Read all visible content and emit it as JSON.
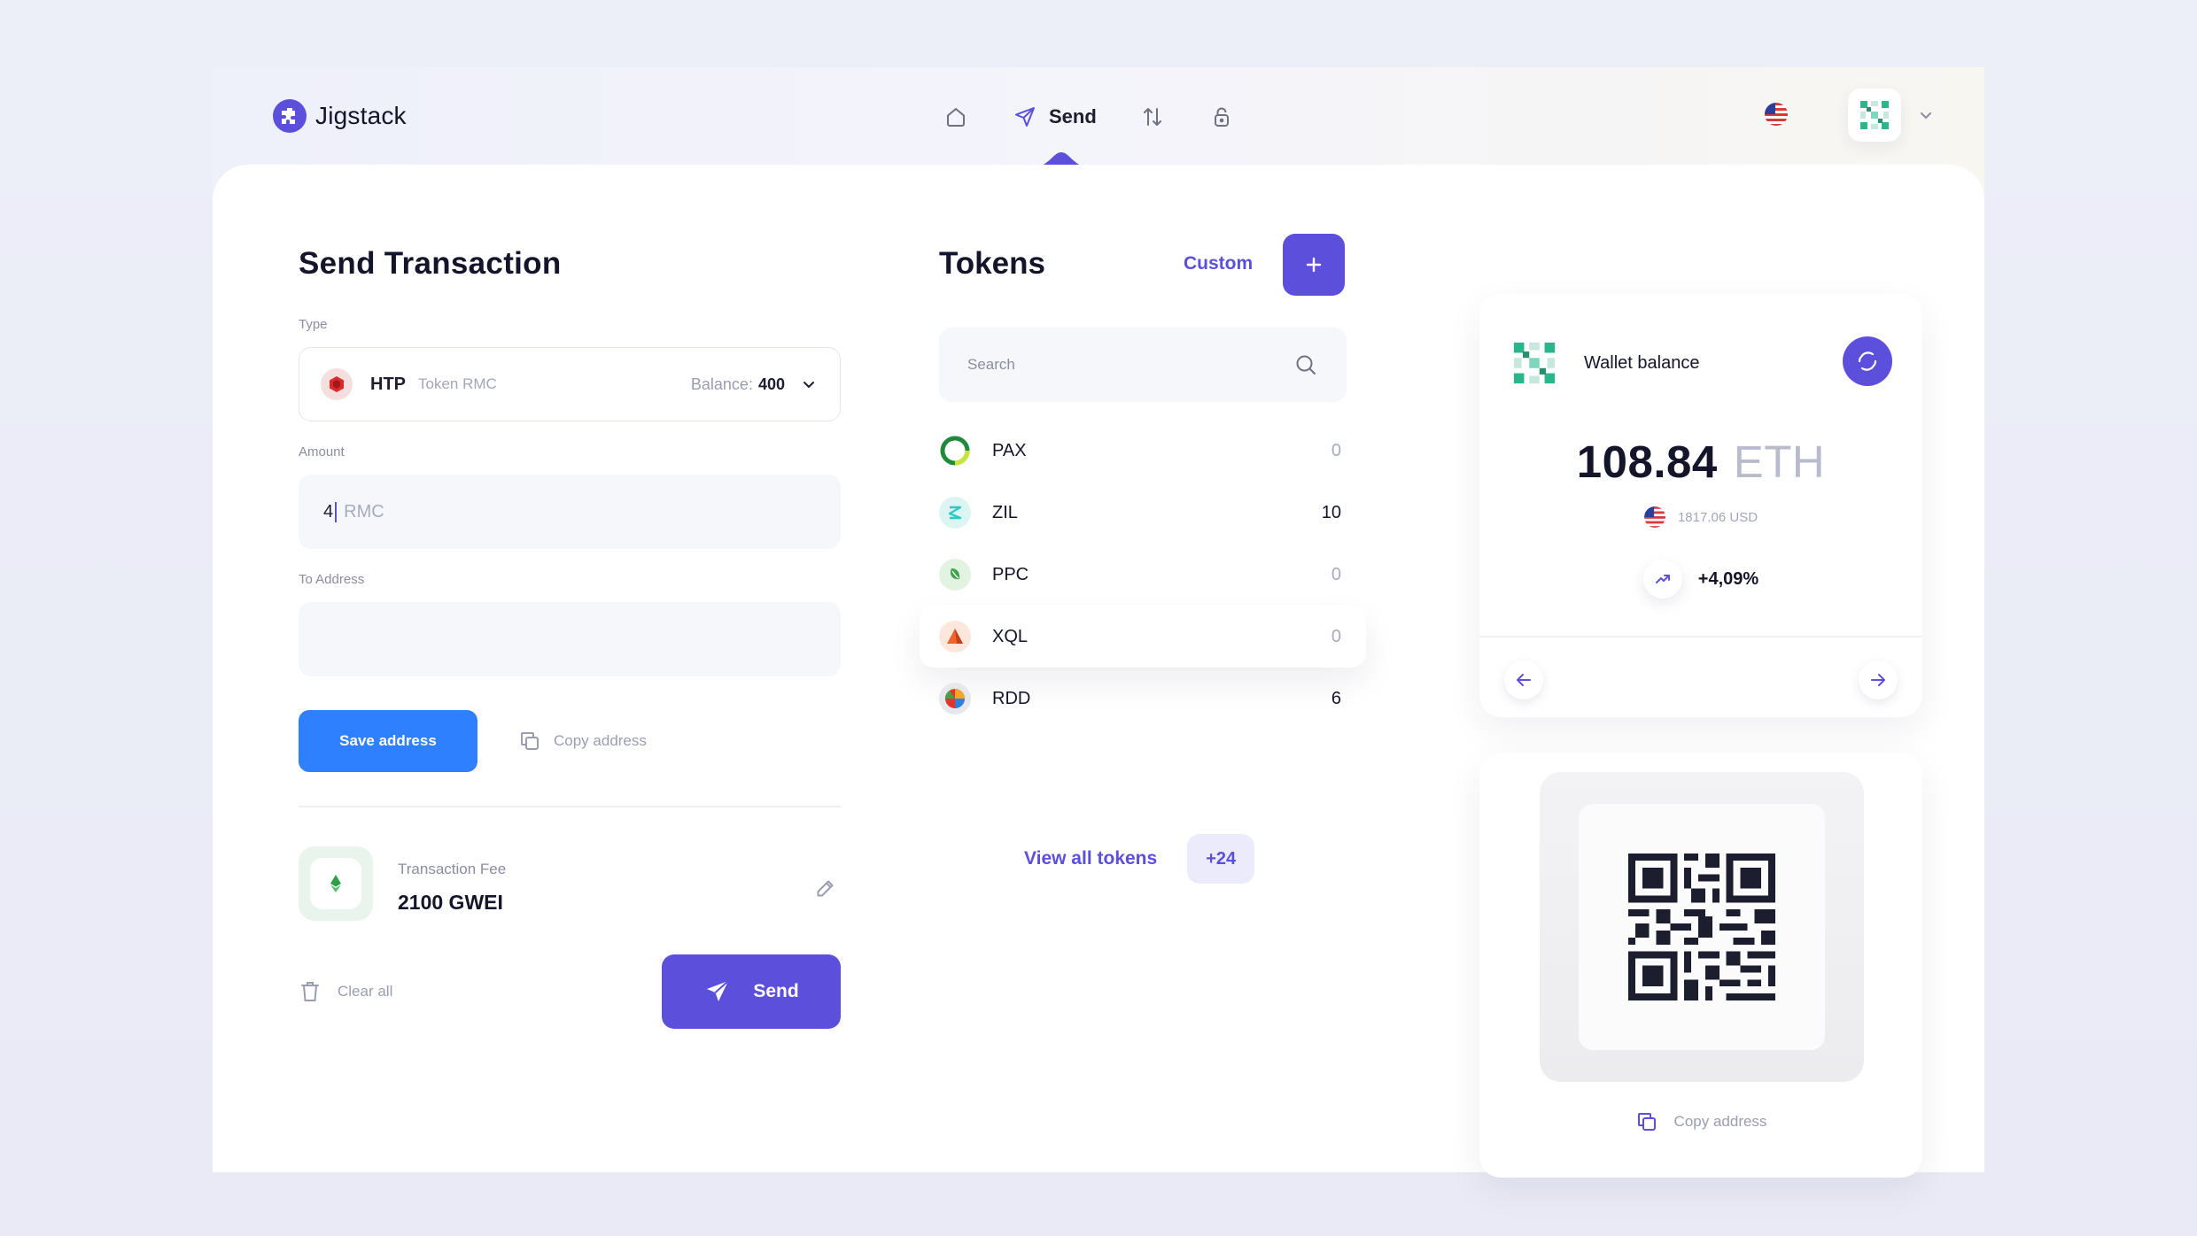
{
  "app": {
    "name": "Jigstack"
  },
  "nav": {
    "items": [
      {
        "name": "home",
        "label": ""
      },
      {
        "name": "send",
        "label": "Send",
        "active": true
      },
      {
        "name": "swap",
        "label": ""
      },
      {
        "name": "lock",
        "label": ""
      }
    ]
  },
  "send": {
    "title": "Send Transaction",
    "type_label": "Type",
    "type_token": "HTP",
    "type_sub": "Token RMC",
    "balance_label": "Balance:",
    "balance_value": "400",
    "amount_label": "Amount",
    "amount_value": "4",
    "amount_unit": "RMC",
    "address_label": "To Address",
    "address_value": "",
    "save_button": "Save address",
    "copy_address": "Copy address",
    "fee_label": "Transaction Fee",
    "fee_value": "2100 GWEI",
    "clear_all": "Clear all",
    "send_button": "Send"
  },
  "tokens": {
    "title": "Tokens",
    "custom_label": "Custom",
    "search_placeholder": "Search",
    "items": [
      {
        "symbol": "PAX",
        "balance": "0",
        "color": "#1f8a3a",
        "icon": "pax-icon"
      },
      {
        "symbol": "ZIL",
        "balance": "10",
        "color": "#29ccc4",
        "icon": "zil-icon"
      },
      {
        "symbol": "PPC",
        "balance": "0",
        "color": "#3ea34b",
        "icon": "ppc-icon"
      },
      {
        "symbol": "XQL",
        "balance": "0",
        "color": "#f0642c",
        "icon": "xql-icon"
      },
      {
        "symbol": "RDD",
        "balance": "6",
        "color": "#e2362b",
        "icon": "rdd-icon"
      }
    ],
    "view_all": "View all tokens",
    "more_count": "+24"
  },
  "wallet": {
    "title": "Wallet balance",
    "amount": "108.84",
    "unit": "ETH",
    "usd": "1817.06 USD",
    "change": "+4,09%",
    "copy_address": "Copy address"
  },
  "colors": {
    "accent": "#5b4fdb",
    "primary_button": "#2e80ff",
    "text_dark": "#14152a",
    "text_muted": "#9a9db1"
  }
}
